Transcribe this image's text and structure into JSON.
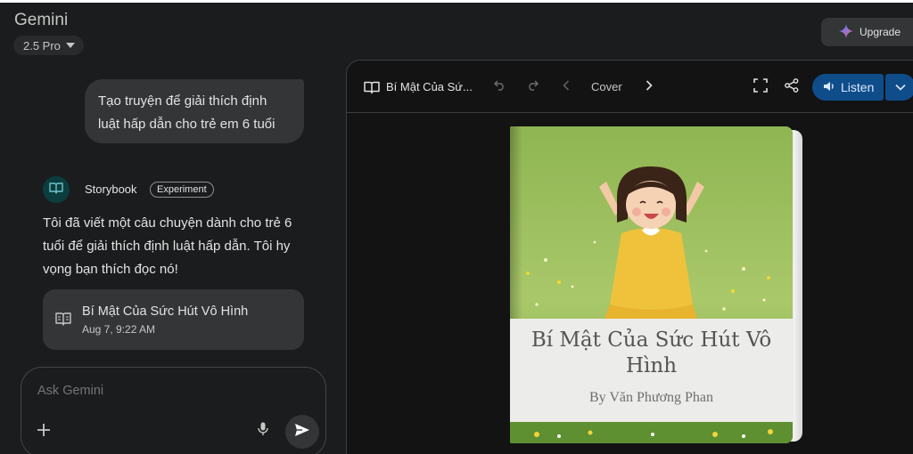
{
  "app": {
    "title": "Gemini",
    "model_label": "2.5 Pro",
    "upgrade_label": "Upgrade"
  },
  "chat": {
    "user_message": "Tạo truyện để giải thích định luật hấp dẫn cho trẻ em 6 tuổi",
    "agent_name": "Storybook",
    "agent_badge": "Experiment",
    "response": "Tôi đã viết một câu chuyện dành cho trẻ 6 tuổi để giải thích định luật hấp dẫn. Tôi hy vọng bạn thích đọc nó!",
    "story_card": {
      "title": "Bí Mật Của Sức Hút Vô Hình",
      "date": "Aug 7, 9:22 AM"
    }
  },
  "input": {
    "placeholder": "Ask Gemini"
  },
  "viewer": {
    "doc_title": "Bí Mật Của Sứ...",
    "page_label": "Cover",
    "listen_label": "Listen",
    "book": {
      "title": "Bí Mật Của Sức Hút Vô Hình",
      "author": "By Văn Phương Phan"
    }
  },
  "colors": {
    "background": "#1b1c1d",
    "panel": "#131314",
    "bubble": "#333537",
    "listen_button": "#0f4d8a",
    "avatar": "#0b3d3e"
  },
  "icons": [
    "sparkle-icon",
    "book-icon",
    "plus-icon",
    "mic-icon",
    "send-icon",
    "undo-icon",
    "redo-icon",
    "chevron-left-icon",
    "chevron-right-icon",
    "fullscreen-icon",
    "share-icon",
    "volume-icon",
    "chevron-down-icon"
  ]
}
